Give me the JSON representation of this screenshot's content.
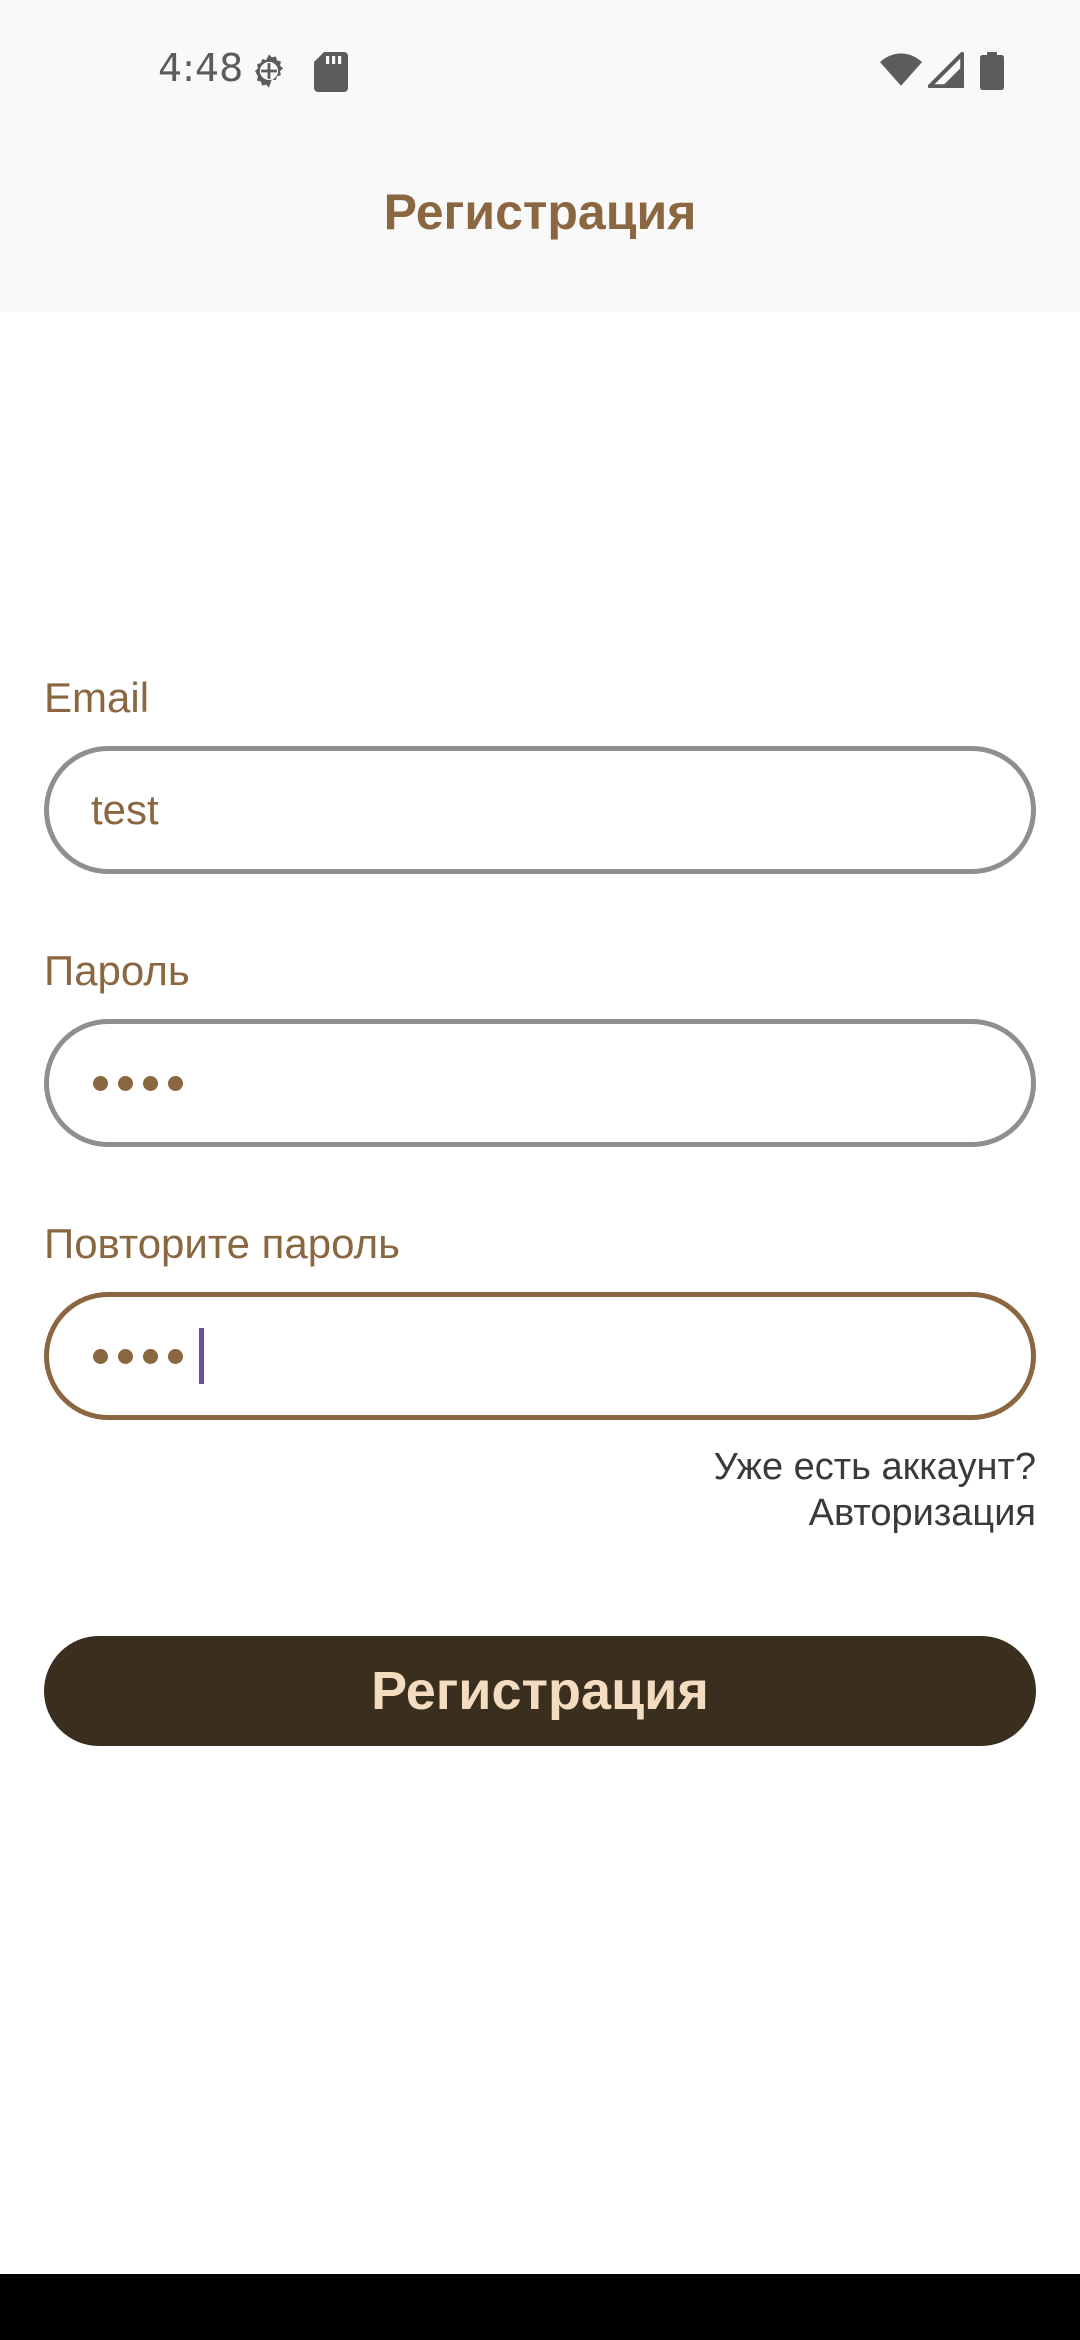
{
  "status_bar": {
    "time": "4:48",
    "icons_left": [
      "gear-icon",
      "sd-card-icon"
    ],
    "icons_right": [
      "wifi-icon",
      "signal-icon",
      "battery-icon"
    ]
  },
  "header": {
    "title": "Регистрация"
  },
  "form": {
    "email": {
      "label": "Email",
      "value": "test"
    },
    "password": {
      "label": "Пароль",
      "masked_length": 4
    },
    "repeat_password": {
      "label": "Повторите пароль",
      "masked_length": 4,
      "focused": true
    },
    "login_prompt": {
      "question": "Уже есть аккаунт?",
      "link": "Авторизация"
    },
    "submit_label": "Регистрация"
  },
  "colors": {
    "accent": "#8a6740",
    "button_bg": "#3a2f1e",
    "button_text": "#f3dcc0",
    "field_border": "#8f8f8f",
    "caret": "#6a4fa0",
    "header_bg": "#f9f9f9"
  }
}
